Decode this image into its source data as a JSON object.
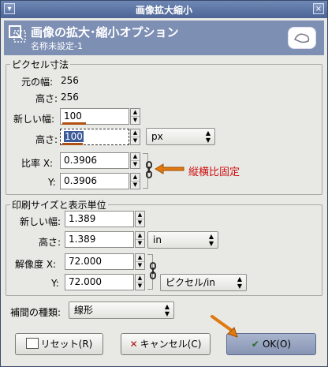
{
  "window": {
    "title": "画像拡大縮小"
  },
  "header": {
    "title": "画像の拡大･縮小オプション",
    "subtitle": "名称未設定-1"
  },
  "pixel_size": {
    "group_label": "ピクセル寸法",
    "orig_width_label": "元の幅:",
    "orig_width_value": "256",
    "orig_height_label": "高さ:",
    "orig_height_value": "256",
    "new_width_label": "新しい幅:",
    "new_width_value": "100",
    "height_label": "高さ:",
    "height_value": "100",
    "unit": "px",
    "ratio_x_label": "比率 X:",
    "ratio_x_value": "0.3906",
    "ratio_y_label": "Y:",
    "ratio_y_value": "0.3906",
    "annotation": "縦横比固定"
  },
  "print_size": {
    "group_label": "印刷サイズと表示単位",
    "new_width_label": "新しい幅:",
    "new_width_value": "1.389",
    "height_label": "高さ:",
    "height_value": "1.389",
    "unit": "in",
    "res_x_label": "解像度 X:",
    "res_x_value": "72.000",
    "res_y_label": "Y:",
    "res_y_value": "72.000",
    "res_unit": "ピクセル/in"
  },
  "interp": {
    "label": "補間の種類:",
    "value": "線形"
  },
  "buttons": {
    "reset": "リセット(R)",
    "cancel": "キャンセル(C)",
    "ok": "OK(O)"
  },
  "colors": {
    "accent_arrow": "#e07a10",
    "annotation": "#cc1010",
    "header_bg": "#7e8fb4"
  }
}
